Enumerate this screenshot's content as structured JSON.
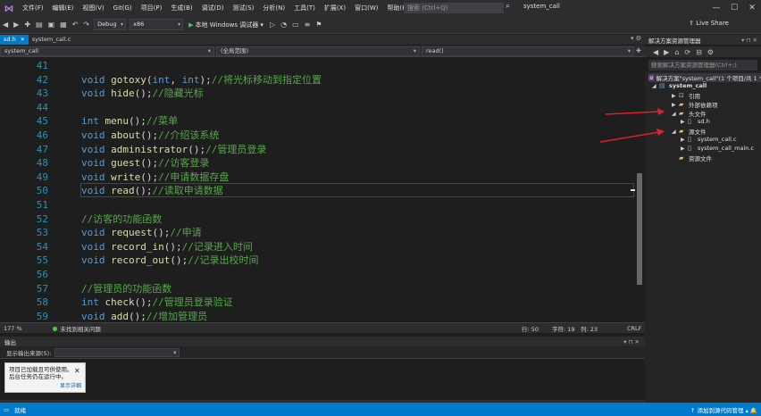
{
  "menubar": {
    "items": [
      "文件(F)",
      "编辑(E)",
      "视图(V)",
      "Git(G)",
      "项目(P)",
      "生成(B)",
      "调试(D)",
      "测试(S)",
      "分析(N)",
      "工具(T)",
      "扩展(X)",
      "窗口(W)",
      "帮助(H)"
    ],
    "search_placeholder": "搜索 (Ctrl+Q)",
    "solution_name": "system_call"
  },
  "toolbar": {
    "config": "Debug",
    "platform": "x86",
    "run_label": "本地 Windows 调试器",
    "live_share": "Live Share"
  },
  "tabs": [
    {
      "label": "sd.h",
      "active": true
    },
    {
      "label": "system_call.c",
      "active": false
    }
  ],
  "navbar": {
    "project": "system_call",
    "scope": "(全局范围)",
    "member": "read()"
  },
  "editor": {
    "lines": [
      {
        "n": "41",
        "parts": []
      },
      {
        "n": "42",
        "parts": [
          [
            "kw",
            "void "
          ],
          [
            "fn",
            "gotoxy"
          ],
          [
            "pl",
            "("
          ],
          [
            "kw",
            "int"
          ],
          [
            "pl",
            ", "
          ],
          [
            "kw",
            "int"
          ],
          [
            "pl",
            ");"
          ],
          [
            "cm",
            "//将光标移动到指定位置"
          ]
        ]
      },
      {
        "n": "43",
        "parts": [
          [
            "kw",
            "void "
          ],
          [
            "fn",
            "hide"
          ],
          [
            "pl",
            "();"
          ],
          [
            "cm",
            "//隐藏光标"
          ]
        ]
      },
      {
        "n": "44",
        "parts": []
      },
      {
        "n": "45",
        "parts": [
          [
            "kw",
            "int "
          ],
          [
            "fn",
            "menu"
          ],
          [
            "pl",
            "();"
          ],
          [
            "cm",
            "//菜单"
          ]
        ]
      },
      {
        "n": "46",
        "parts": [
          [
            "kw",
            "void "
          ],
          [
            "fn",
            "about"
          ],
          [
            "pl",
            "();"
          ],
          [
            "cm",
            "//介绍该系统"
          ]
        ]
      },
      {
        "n": "47",
        "parts": [
          [
            "kw",
            "void "
          ],
          [
            "fn",
            "administrator"
          ],
          [
            "pl",
            "();"
          ],
          [
            "cm",
            "//管理员登录"
          ]
        ]
      },
      {
        "n": "48",
        "parts": [
          [
            "kw",
            "void "
          ],
          [
            "fn",
            "guest"
          ],
          [
            "pl",
            "();"
          ],
          [
            "cm",
            "//访客登录"
          ]
        ]
      },
      {
        "n": "49",
        "parts": [
          [
            "kw",
            "void "
          ],
          [
            "fn",
            "write"
          ],
          [
            "pl",
            "();"
          ],
          [
            "cm",
            "//申请数据存盘"
          ]
        ]
      },
      {
        "n": "50",
        "parts": [
          [
            "kw",
            "void "
          ],
          [
            "fn",
            "read"
          ],
          [
            "pl",
            "();"
          ],
          [
            "cm",
            "//读取申请数据"
          ]
        ]
      },
      {
        "n": "51",
        "parts": []
      },
      {
        "n": "52",
        "parts": [
          [
            "cm",
            "//访客的功能函数"
          ]
        ]
      },
      {
        "n": "53",
        "parts": [
          [
            "kw",
            "void "
          ],
          [
            "fn",
            "request"
          ],
          [
            "pl",
            "();"
          ],
          [
            "cm",
            "//申请"
          ]
        ]
      },
      {
        "n": "54",
        "parts": [
          [
            "kw",
            "void "
          ],
          [
            "fn",
            "record_in"
          ],
          [
            "pl",
            "();"
          ],
          [
            "cm",
            "//记录进入时间"
          ]
        ]
      },
      {
        "n": "55",
        "parts": [
          [
            "kw",
            "void "
          ],
          [
            "fn",
            "record_out"
          ],
          [
            "pl",
            "();"
          ],
          [
            "cm",
            "//记录出校时间"
          ]
        ]
      },
      {
        "n": "56",
        "parts": []
      },
      {
        "n": "57",
        "parts": [
          [
            "cm",
            "//管理员的功能函数"
          ]
        ]
      },
      {
        "n": "58",
        "parts": [
          [
            "kw",
            "int "
          ],
          [
            "fn",
            "check"
          ],
          [
            "pl",
            "();"
          ],
          [
            "cm",
            "//管理员登录验证"
          ]
        ]
      },
      {
        "n": "59",
        "parts": [
          [
            "kw",
            "void "
          ],
          [
            "fn",
            "add"
          ],
          [
            "pl",
            "();"
          ],
          [
            "cm",
            "//增加管理员"
          ]
        ]
      }
    ]
  },
  "edstatus": {
    "zoom": "177 %",
    "issues": "未找到相关问题",
    "line": "行: 50",
    "char": "字符: 19",
    "col": "列: 23",
    "eol": "CRLF"
  },
  "output": {
    "title": "输出",
    "source_label": "显示输出来源(S):",
    "toast_text": "项目已加载且可供使用。后台任务仍在运行中。",
    "toast_link": "显示详细"
  },
  "solution_explorer": {
    "title": "解决方案资源管理器",
    "search_placeholder": "搜索解决方案资源管理器(Ctrl+;)",
    "nodes": [
      {
        "label": "解决方案\"system_call\"(1 个项目/共 1 个)",
        "kind": "sln"
      },
      {
        "label": "system_call",
        "kind": "proj"
      },
      {
        "label": "引用",
        "kind": "ref"
      },
      {
        "label": "外部依赖项",
        "kind": "fold"
      },
      {
        "label": "头文件",
        "kind": "fold"
      },
      {
        "label": "sd.h",
        "kind": "h"
      },
      {
        "label": "源文件",
        "kind": "fold"
      },
      {
        "label": "system_call.c",
        "kind": "c"
      },
      {
        "label": "system_call_main.c",
        "kind": "c"
      },
      {
        "label": "资源文件",
        "kind": "fold"
      }
    ]
  },
  "statusbar": {
    "ready": "就绪",
    "source_control": "添加到源代码管理"
  },
  "colors": {
    "accent": "#007acc",
    "keyword": "#569cd6",
    "comment": "#57a64a",
    "line_number": "#2b91af",
    "annotation_arrow": "#e0202a"
  }
}
